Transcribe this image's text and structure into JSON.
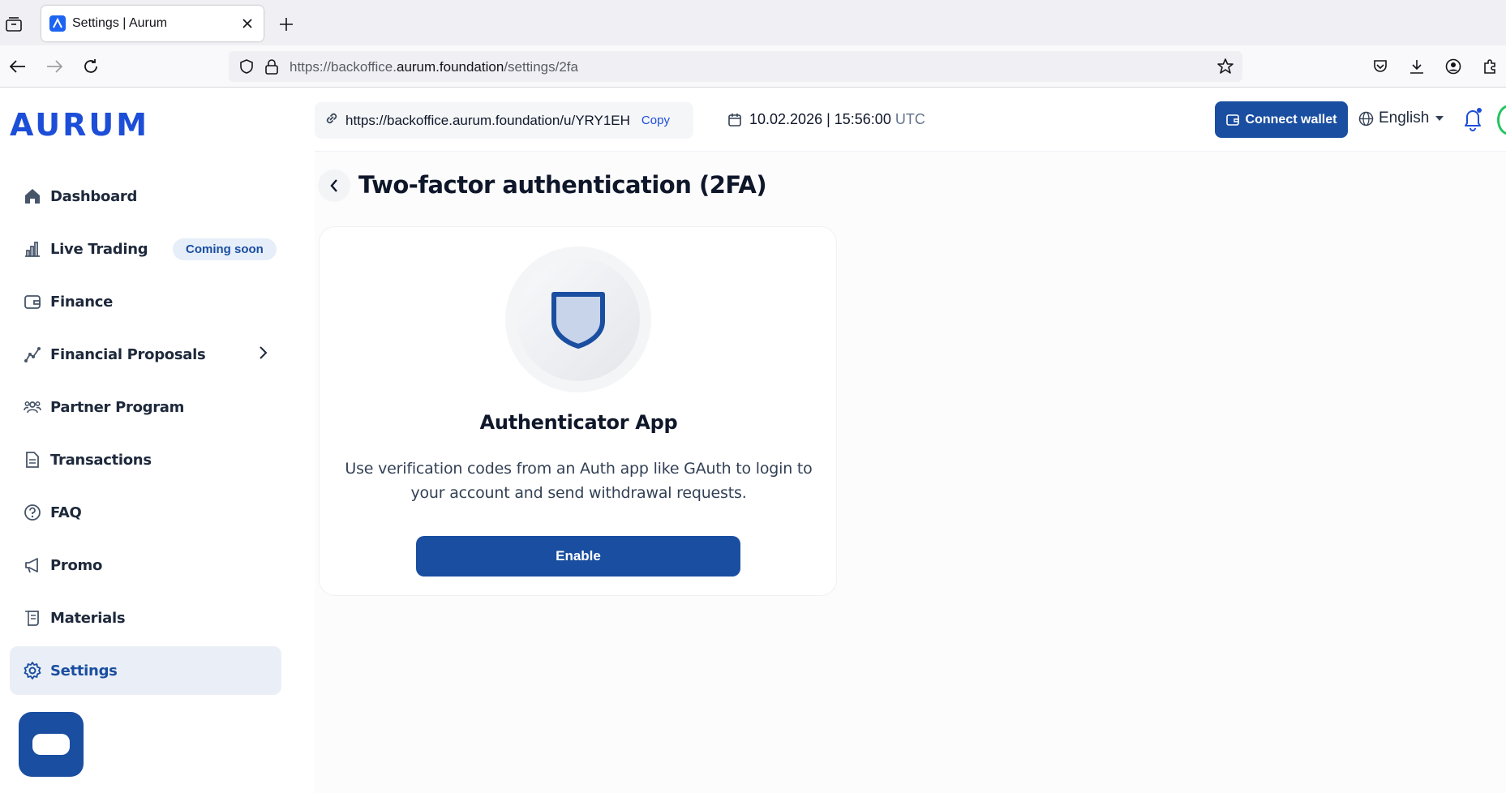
{
  "browser": {
    "tab_title": "Settings | Aurum",
    "url_prefix": "https://backoffice.",
    "url_host": "aurum.foundation",
    "url_path": "/settings/2fa"
  },
  "app": {
    "logo": "AURUM",
    "referral_link": "https://backoffice.aurum.foundation/u/YRY1EH",
    "copy_label": "Copy",
    "date": "10.02.2026 | 15:56:00",
    "timezone": "UTC",
    "connect_wallet_label": "Connect wallet",
    "language": "English"
  },
  "sidebar": {
    "items": [
      {
        "label": "Dashboard",
        "icon": "home-icon"
      },
      {
        "label": "Live Trading",
        "icon": "bar-chart-icon",
        "badge": "Coming soon"
      },
      {
        "label": "Finance",
        "icon": "wallet-icon"
      },
      {
        "label": "Financial Proposals",
        "icon": "trend-icon"
      },
      {
        "label": "Partner Program",
        "icon": "users-icon"
      },
      {
        "label": "Transactions",
        "icon": "document-icon"
      },
      {
        "label": "FAQ",
        "icon": "question-icon"
      },
      {
        "label": "Promo",
        "icon": "megaphone-icon"
      },
      {
        "label": "Materials",
        "icon": "scroll-icon"
      },
      {
        "label": "Settings",
        "icon": "gear-icon",
        "active": true
      }
    ]
  },
  "page": {
    "title": "Two-factor authentication (2FA)"
  },
  "card": {
    "title": "Authenticator App",
    "description": "Use verification codes from an Auth app like GAuth to login to your account and send withdrawal requests.",
    "button_label": "Enable"
  },
  "colors": {
    "primary": "#1a4ea0",
    "active_bg": "#eaeff7",
    "text": "#0f172a"
  }
}
